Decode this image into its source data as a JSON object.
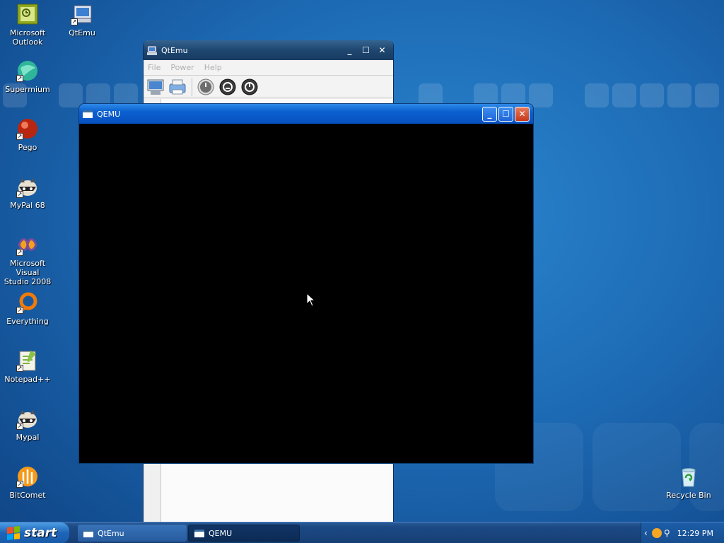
{
  "desktop": {
    "icons": [
      {
        "label": "Microsoft\nOutlook",
        "icon": "outlook-icon"
      },
      {
        "label": "QtEmu",
        "icon": "qtemu-icon"
      },
      {
        "label": "Supermium",
        "icon": "supermium-icon"
      },
      {
        "label": "Pego",
        "icon": "pego-icon"
      },
      {
        "label": "MyPal 68",
        "icon": "mypal-icon"
      },
      {
        "label": "Microsoft Visual\nStudio 2008",
        "icon": "visual-studio-icon"
      },
      {
        "label": "Everything",
        "icon": "everything-icon"
      },
      {
        "label": "Notepad++",
        "icon": "notepad-plus-plus-icon"
      },
      {
        "label": "Mypal",
        "icon": "mypal-icon"
      },
      {
        "label": "BitComet",
        "icon": "bitcomet-icon"
      },
      {
        "label": "Recycle Bin",
        "icon": "recycle-bin-icon"
      }
    ]
  },
  "qtemu_window": {
    "title": "QtEmu",
    "menu": {
      "file": "File",
      "power": "Power",
      "help": "Help"
    }
  },
  "qemu_window": {
    "title": "QEMU"
  },
  "taskbar": {
    "start_label": "start",
    "tasks": [
      {
        "label": "QtEmu",
        "active": false
      },
      {
        "label": "QEMU",
        "active": true
      }
    ],
    "clock": "12:29 PM"
  },
  "colors": {
    "titlebar_active": "#0b5fcf",
    "titlebar_inactive": "#1e4670",
    "close_button": "#c8391a",
    "desktop": "#1d6ab4"
  }
}
